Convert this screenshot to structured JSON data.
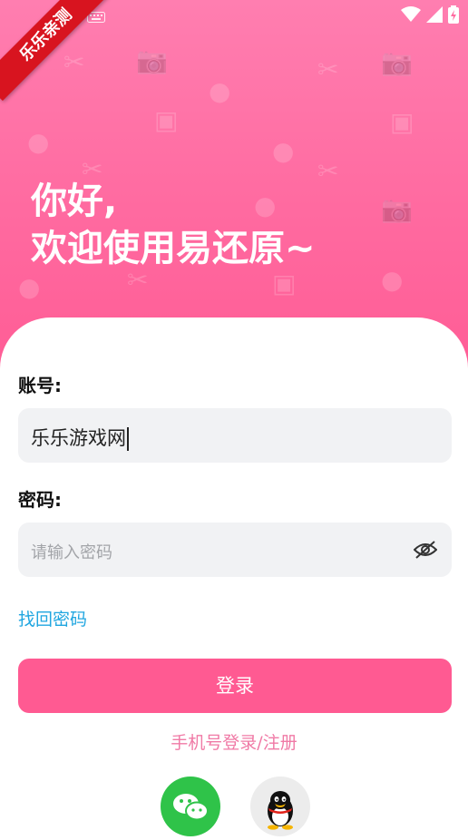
{
  "badge": {
    "text": "乐乐亲测"
  },
  "greeting": {
    "line1": "你好,",
    "line2": "欢迎使用易还原~"
  },
  "form": {
    "account_label": "账号:",
    "account_value": "乐乐游戏网",
    "password_label": "密码:",
    "password_placeholder": "请输入密码"
  },
  "links": {
    "forgot": "找回密码",
    "phone_login": "手机号登录/注册"
  },
  "buttons": {
    "login": "登录"
  },
  "social": {
    "items": [
      "wechat-icon",
      "qq-icon"
    ]
  },
  "colors": {
    "primary": "#ff5a92",
    "link": "#20a6e0",
    "hero": "#ff6aa0",
    "badge": "#d8141f"
  }
}
